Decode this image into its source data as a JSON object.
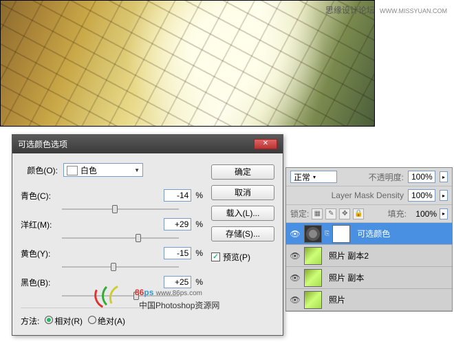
{
  "watermark": {
    "text": "思缘设计论坛",
    "url": "WWW.MISSYUAN.COM"
  },
  "dialog": {
    "title": "可选颜色选项",
    "colors_label": "颜色(O):",
    "selected_color": "白色",
    "sliders": [
      {
        "label": "青色(C):",
        "value": -14,
        "thumb_pct": 43
      },
      {
        "label": "洋红(M):",
        "value": 29,
        "thumb_pct": 63
      },
      {
        "label": "黄色(Y):",
        "value": -15,
        "thumb_pct": 42
      },
      {
        "label": "黑色(B):",
        "value": 25,
        "thumb_pct": 61
      }
    ],
    "percent_sign": "%",
    "method_label": "方法:",
    "method_relative": "相对(R)",
    "method_absolute": "绝对(A)",
    "buttons": {
      "ok": "确定",
      "cancel": "取消",
      "load": "载入(L)...",
      "save": "存储(S)..."
    },
    "preview_label": "预览(P)"
  },
  "layers": {
    "blend_mode": "正常",
    "opacity_label": "不透明度:",
    "opacity_value": "100%",
    "density_label": "Layer Mask Density",
    "density_value": "100%",
    "lock_label": "锁定:",
    "fill_label": "填充:",
    "fill_value": "100%",
    "items": [
      {
        "name": "可选颜色",
        "type": "adjustment",
        "selected": true
      },
      {
        "name": "照片 副本2",
        "type": "image",
        "selected": false
      },
      {
        "name": "照片 副本",
        "type": "image",
        "selected": false
      },
      {
        "name": "照片",
        "type": "image",
        "selected": false
      }
    ]
  },
  "logo": {
    "brand": "86",
    "brand_suffix": "ps",
    "url": "www.86ps.com",
    "cn": "中国Photoshop资源网"
  }
}
